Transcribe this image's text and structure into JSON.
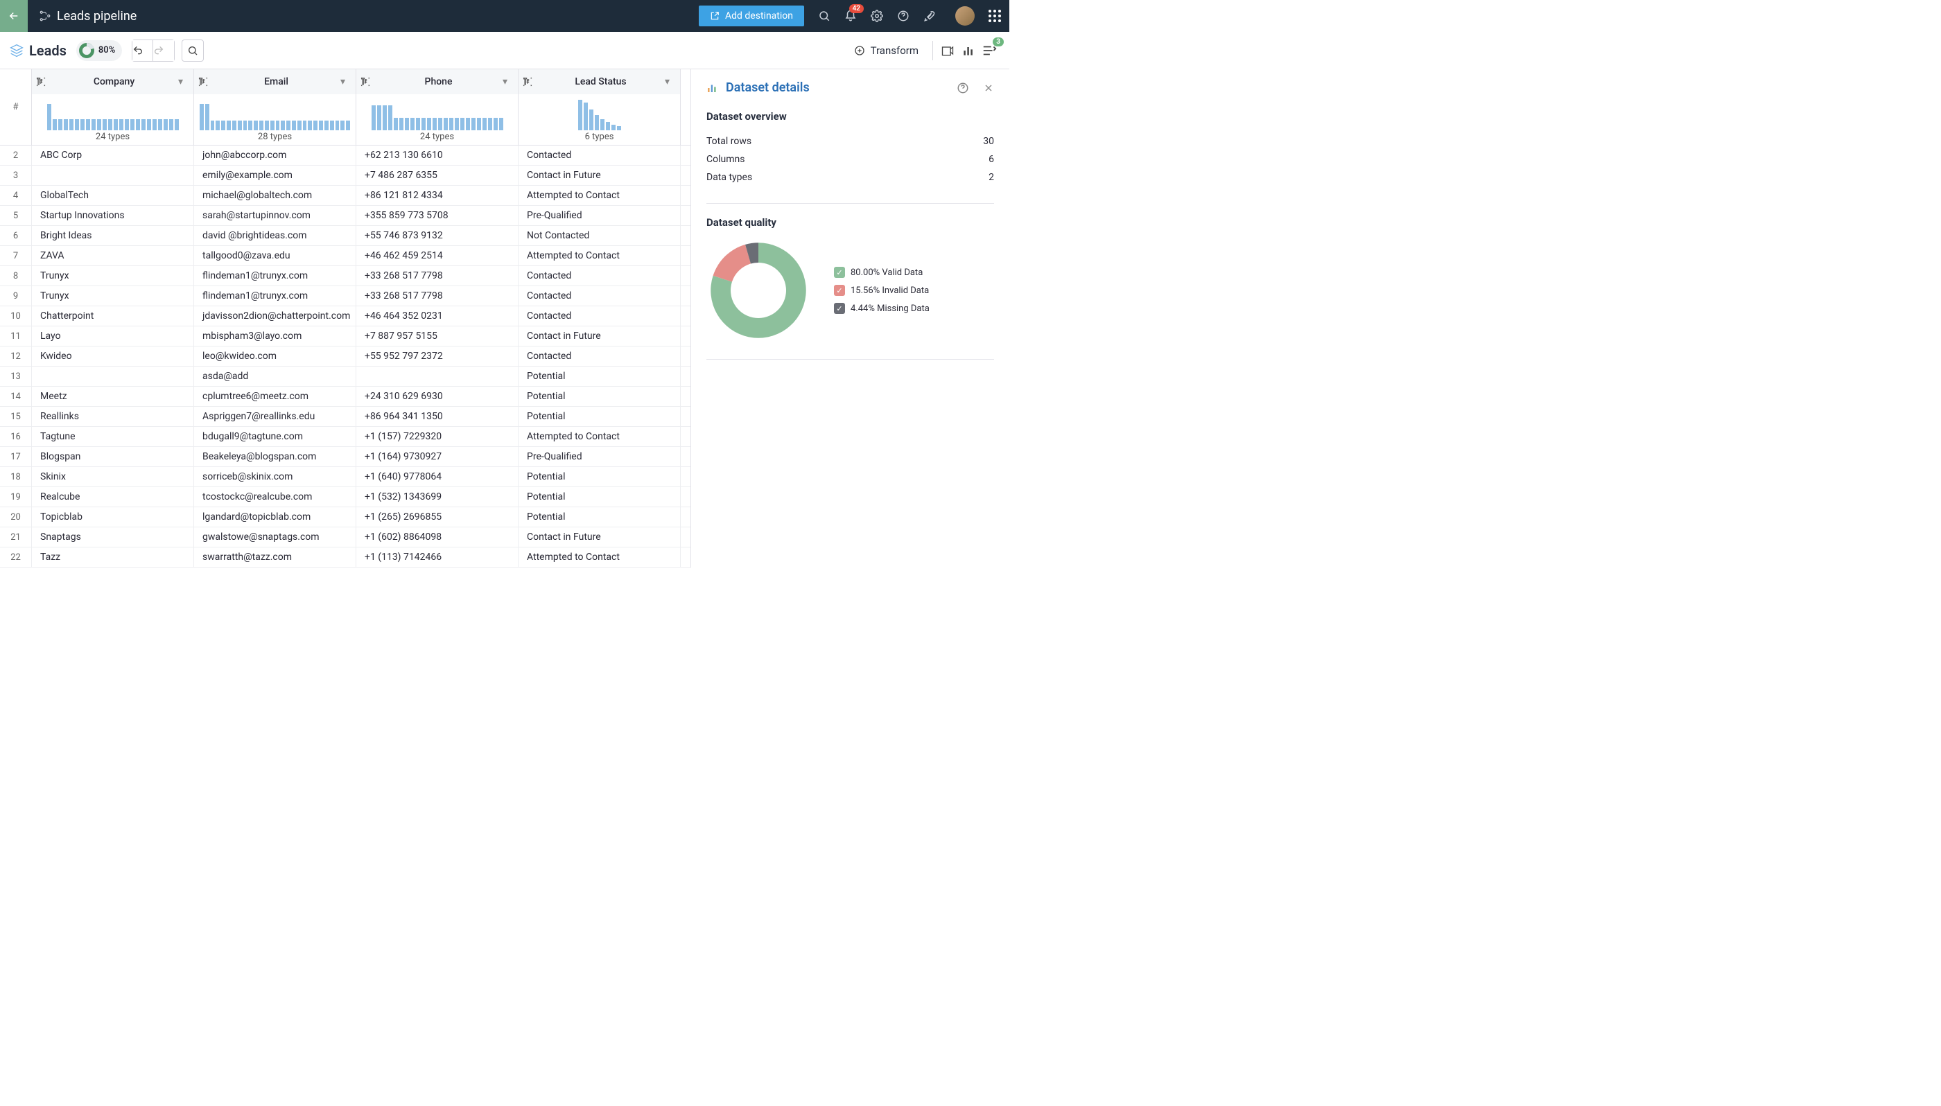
{
  "header": {
    "page_title": "Leads pipeline",
    "add_destination_label": "Add destination",
    "notification_count": "42"
  },
  "toolbar": {
    "dataset_name": "Leads",
    "quality_pct": "80%",
    "transform_label": "Transform",
    "steps_count": "3"
  },
  "columns": [
    {
      "key": "company",
      "label": "Company",
      "types": "24 types"
    },
    {
      "key": "email",
      "label": "Email",
      "types": "28 types"
    },
    {
      "key": "phone",
      "label": "Phone",
      "types": "24 types"
    },
    {
      "key": "status",
      "label": "Lead Status",
      "types": "6 types"
    }
  ],
  "rows": [
    {
      "n": 2,
      "company": "ABC Corp",
      "email": "john@abccorp.com",
      "phone": "+62 213 130 6610",
      "status": "Contacted"
    },
    {
      "n": 3,
      "company": "",
      "email": "emily@example.com",
      "phone": "+7 486 287 6355",
      "status": "Contact in Future"
    },
    {
      "n": 4,
      "company": "GlobalTech",
      "email": "michael@globaltech.com",
      "phone": "+86 121 812 4334",
      "status": "Attempted to Contact"
    },
    {
      "n": 5,
      "company": "Startup Innovations",
      "email": "sarah@startupinnov.com",
      "phone": "+355 859 773 5708",
      "status": "Pre-Qualified"
    },
    {
      "n": 6,
      "company": "Bright Ideas",
      "email": "david  @brightideas.com",
      "phone": "+55 746 873 9132",
      "status": "Not Contacted"
    },
    {
      "n": 7,
      "company": "ZAVA",
      "email": "tallgood0@zava.edu",
      "phone": "+46 462 459 2514",
      "status": "Attempted to Contact"
    },
    {
      "n": 8,
      "company": "Trunyx",
      "email": "flindeman1@trunyx.com",
      "phone": "+33 268 517 7798",
      "status": "Contacted"
    },
    {
      "n": 9,
      "company": "Trunyx",
      "email": "flindeman1@trunyx.com",
      "phone": "+33 268 517 7798",
      "status": "Contacted"
    },
    {
      "n": 10,
      "company": "Chatterpoint",
      "email": "jdavisson2dion@chatterpoint.com",
      "phone": "+46 464 352 0231",
      "status": "Contacted"
    },
    {
      "n": 11,
      "company": "Layo",
      "email": "mbispham3@layo.com",
      "phone": "+7 887 957 5155",
      "status": "Contact in Future"
    },
    {
      "n": 12,
      "company": "Kwideo",
      "email": "leo@kwideo.com",
      "phone": "+55 952 797 2372",
      "status": "Contacted"
    },
    {
      "n": 13,
      "company": "",
      "email": "asda@add",
      "phone": "",
      "status": "Potential"
    },
    {
      "n": 14,
      "company": "Meetz",
      "email": "cplumtree6@meetz.com",
      "phone": "+24 310 629 6930",
      "status": "Potential"
    },
    {
      "n": 15,
      "company": "Reallinks",
      "email": "Aspriggen7@reallinks.edu",
      "phone": "+86 964 341 1350",
      "status": "Potential"
    },
    {
      "n": 16,
      "company": "Tagtune",
      "email": "bdugall9@tagtune.com",
      "phone": "+1 (157) 7229320",
      "status": "Attempted to Contact"
    },
    {
      "n": 17,
      "company": "Blogspan",
      "email": "Beakeleya@blogspan.com",
      "phone": "+1 (164) 9730927",
      "status": "Pre-Qualified"
    },
    {
      "n": 18,
      "company": "Skinix",
      "email": "sorriceb@skinix.com",
      "phone": "+1 (640) 9778064",
      "status": "Potential"
    },
    {
      "n": 19,
      "company": "Realcube",
      "email": "tcostockc@realcube.com",
      "phone": "+1 (532) 1343699",
      "status": "Potential"
    },
    {
      "n": 20,
      "company": "Topicblab",
      "email": "lgandard@topicblab.com",
      "phone": "+1 (265) 2696855",
      "status": "Potential"
    },
    {
      "n": 21,
      "company": "Snaptags",
      "email": "gwalstowe@snaptags.com",
      "phone": "+1 (602) 8864098",
      "status": "Contact in Future"
    },
    {
      "n": 22,
      "company": "Tazz",
      "email": "swarratth@tazz.com",
      "phone": "+1 (113) 7142466",
      "status": "Attempted to Contact"
    }
  ],
  "panel": {
    "title": "Dataset details",
    "overview_heading": "Dataset overview",
    "overview": [
      {
        "label": "Total rows",
        "value": "30"
      },
      {
        "label": "Columns",
        "value": "6"
      },
      {
        "label": "Data types",
        "value": "2"
      }
    ],
    "quality_heading": "Dataset quality",
    "quality": [
      {
        "label": "80.00% Valid Data",
        "color": "#8dc09c",
        "pct": 80.0
      },
      {
        "label": "15.56% Invalid Data",
        "color": "#e58e89",
        "pct": 15.56
      },
      {
        "label": "4.44% Missing Data",
        "color": "#6a6d75",
        "pct": 4.44
      }
    ]
  },
  "histograms": {
    "company": [
      38,
      16,
      16,
      16,
      16,
      16,
      16,
      16,
      16,
      16,
      16,
      16,
      16,
      16,
      16,
      16,
      16,
      16,
      16,
      16,
      16,
      16,
      16,
      16
    ],
    "email": [
      38,
      38,
      14,
      14,
      14,
      14,
      14,
      14,
      14,
      14,
      14,
      14,
      14,
      14,
      14,
      14,
      14,
      14,
      14,
      14,
      14,
      14,
      14,
      14,
      14,
      14,
      14,
      14
    ],
    "phone": [
      36,
      36,
      36,
      36,
      18,
      18,
      18,
      18,
      18,
      18,
      18,
      18,
      18,
      18,
      18,
      18,
      18,
      18,
      18,
      18,
      18,
      18,
      18,
      18
    ],
    "status": [
      44,
      40,
      30,
      22,
      16,
      12,
      8,
      6
    ]
  },
  "chart_data": {
    "type": "pie",
    "title": "Dataset quality",
    "series": [
      {
        "name": "Valid Data",
        "value": 80.0
      },
      {
        "name": "Invalid Data",
        "value": 15.56
      },
      {
        "name": "Missing Data",
        "value": 4.44
      }
    ]
  }
}
